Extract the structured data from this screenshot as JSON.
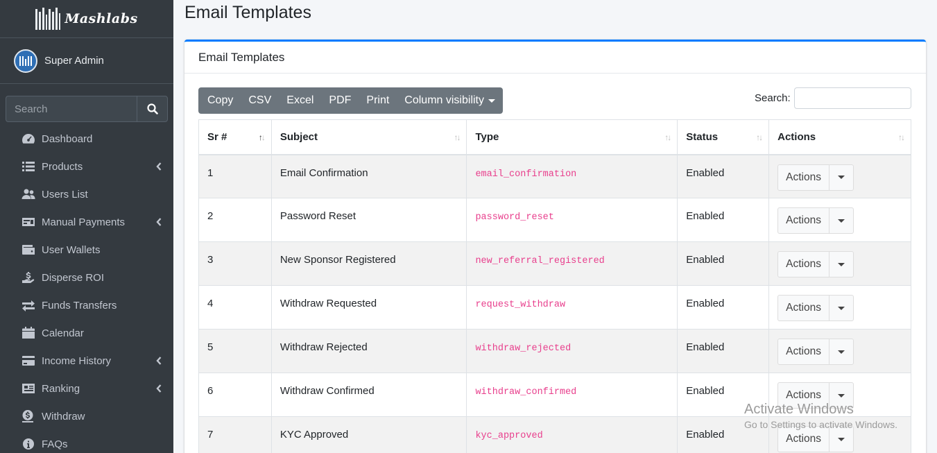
{
  "brand": {
    "name": "Mashlabs"
  },
  "user": {
    "name": "Super Admin"
  },
  "sidebar": {
    "search_placeholder": "Search",
    "items": [
      {
        "label": "Dashboard",
        "icon": "dashboard-icon",
        "has_submenu": false
      },
      {
        "label": "Products",
        "icon": "list-icon",
        "has_submenu": true
      },
      {
        "label": "Users List",
        "icon": "users-icon",
        "has_submenu": false
      },
      {
        "label": "Manual Payments",
        "icon": "money-check-icon",
        "has_submenu": true
      },
      {
        "label": "User Wallets",
        "icon": "wallet-icon",
        "has_submenu": false
      },
      {
        "label": "Disperse ROI",
        "icon": "hand-holding-usd-icon",
        "has_submenu": false
      },
      {
        "label": "Funds Transfers",
        "icon": "exchange-icon",
        "has_submenu": false
      },
      {
        "label": "Calendar",
        "icon": "calendar-icon",
        "has_submenu": false
      },
      {
        "label": "Income History",
        "icon": "credit-card-icon",
        "has_submenu": true
      },
      {
        "label": "Ranking",
        "icon": "id-card-icon",
        "has_submenu": true
      },
      {
        "label": "Withdraw",
        "icon": "dollar-circle-icon",
        "has_submenu": false
      },
      {
        "label": "FAQs",
        "icon": "info-circle-icon",
        "has_submenu": false
      }
    ]
  },
  "page": {
    "title": "Email Templates"
  },
  "card": {
    "title": "Email Templates"
  },
  "toolbar": {
    "buttons": [
      "Copy",
      "CSV",
      "Excel",
      "PDF",
      "Print"
    ],
    "column_visibility": "Column visibility",
    "search_label": "Search:",
    "search_value": ""
  },
  "table": {
    "columns": [
      "Sr #",
      "Subject",
      "Type",
      "Status",
      "Actions"
    ],
    "rows": [
      {
        "sr": "1",
        "subject": "Email Confirmation",
        "type": "email_confirmation",
        "status": "Enabled",
        "action": "Actions"
      },
      {
        "sr": "2",
        "subject": "Password Reset",
        "type": "password_reset",
        "status": "Enabled",
        "action": "Actions"
      },
      {
        "sr": "3",
        "subject": "New Sponsor Registered",
        "type": "new_referral_registered",
        "status": "Enabled",
        "action": "Actions"
      },
      {
        "sr": "4",
        "subject": "Withdraw Requested",
        "type": "request_withdraw",
        "status": "Enabled",
        "action": "Actions"
      },
      {
        "sr": "5",
        "subject": "Withdraw Rejected",
        "type": "withdraw_rejected",
        "status": "Enabled",
        "action": "Actions"
      },
      {
        "sr": "6",
        "subject": "Withdraw Confirmed",
        "type": "withdraw_confirmed",
        "status": "Enabled",
        "action": "Actions"
      },
      {
        "sr": "7",
        "subject": "KYC Approved",
        "type": "kyc_approved",
        "status": "Enabled",
        "action": "Actions"
      }
    ]
  },
  "watermark": {
    "title": "Activate Windows",
    "subtitle": "Go to Settings to activate Windows."
  },
  "colors": {
    "sidebar_bg": "#343a40",
    "accent": "#007bff",
    "code": "#e83e8c",
    "toolbar_bg": "#6c757d"
  }
}
